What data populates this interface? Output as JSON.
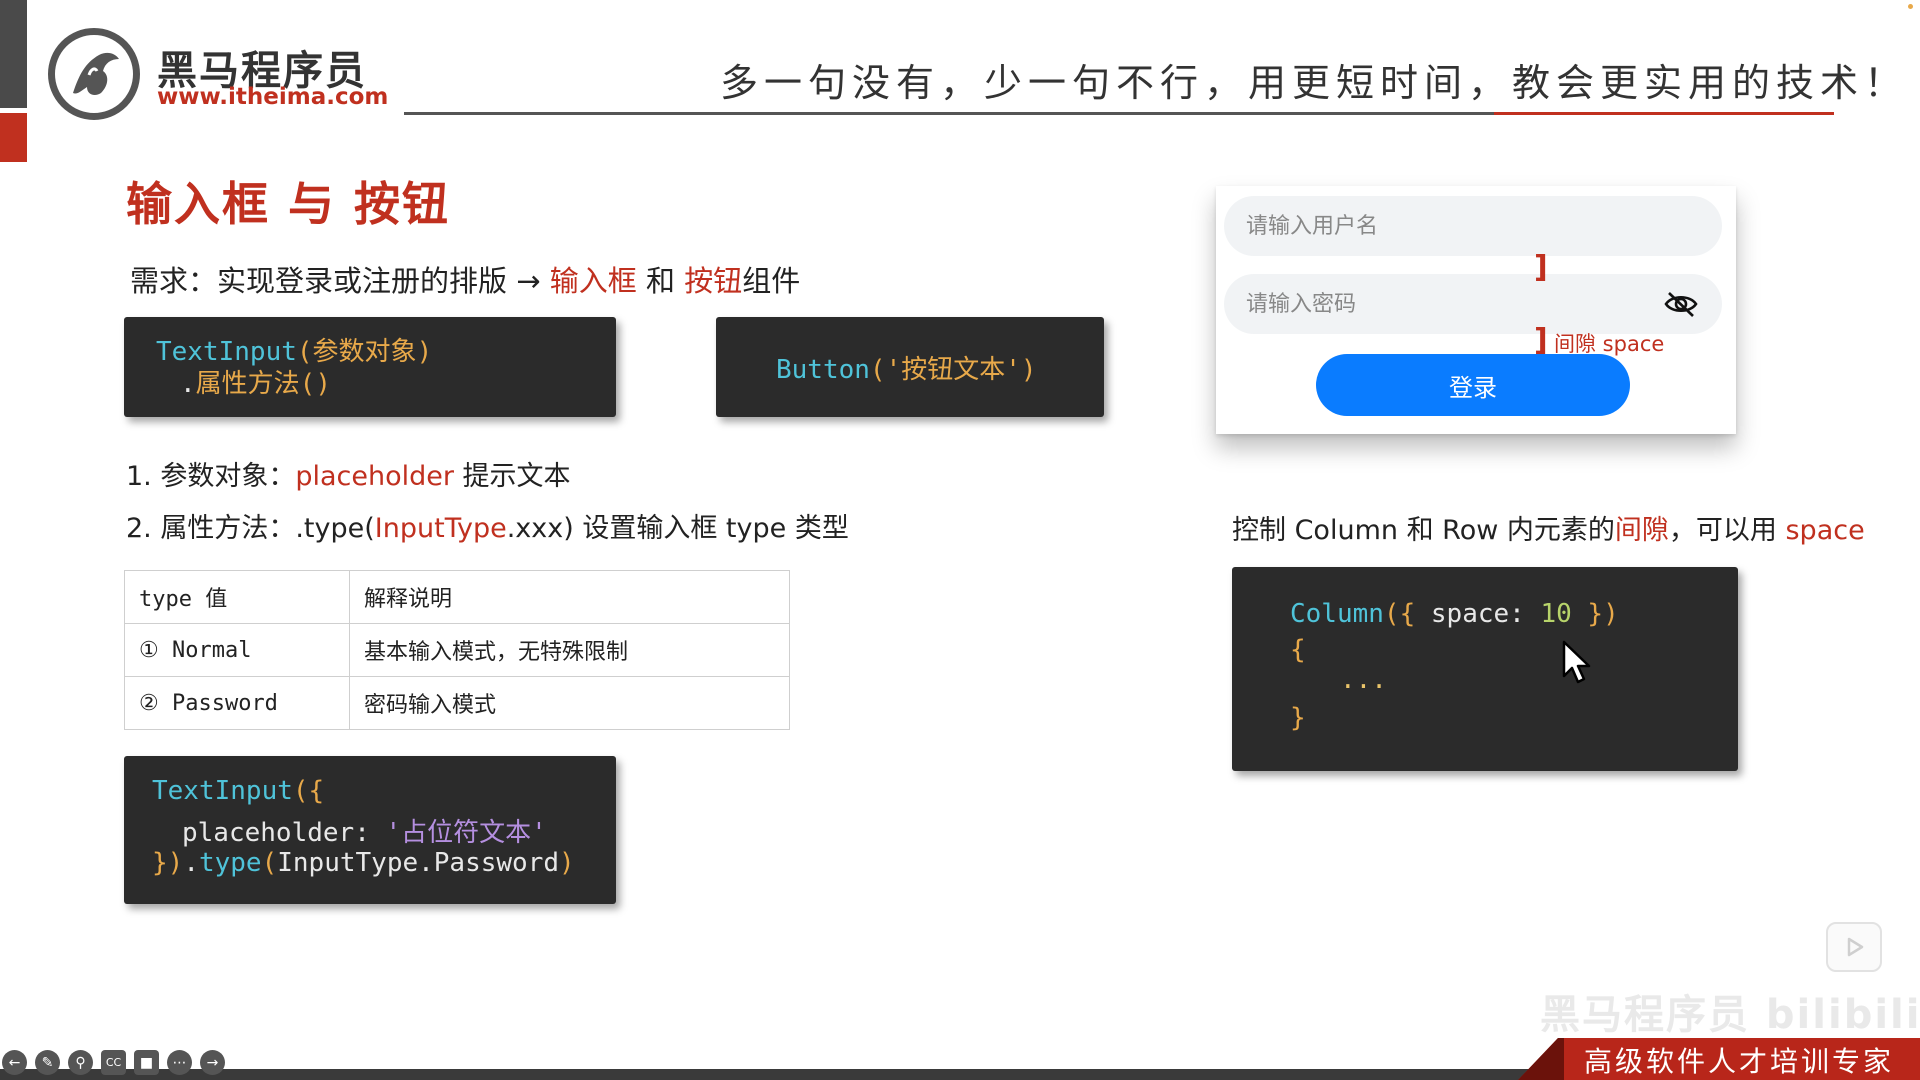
{
  "logo": {
    "name": "黑马程序员",
    "url": "www.itheima.com"
  },
  "header": {
    "slogan": "多一句没有，少一句不行，用更短时间，教会更实用的技术！"
  },
  "title": "输入框 与 按钮",
  "requirement": {
    "prefix": "需求：实现登录或注册的排版 → ",
    "input_word": "输入框",
    "and": " 和 ",
    "button_word": "按钮",
    "suffix": "组件"
  },
  "code_textinput": {
    "line1_name": "TextInput",
    "line1_open": "(",
    "line1_arg": "参数对象",
    "line1_close": ")",
    "line2_dot": ".",
    "line2_method": "属性方法",
    "line2_parens": "()"
  },
  "code_button": {
    "name": "Button",
    "open": "(",
    "arg": "'按钮文本'",
    "close": ")"
  },
  "notes": {
    "note1_prefix": "1. 参数对象：",
    "note1_highlight": "placeholder",
    "note1_suffix": " 提示文本",
    "note2_prefix": "2. 属性方法：.type(",
    "note2_highlight": "InputType",
    "note2_suffix": ".xxx)  设置输入框 type 类型"
  },
  "type_table": {
    "headers": [
      "type 值",
      "解释说明"
    ],
    "rows": [
      [
        "① Normal",
        "基本输入模式，无特殊限制"
      ],
      [
        "② Password",
        "密码输入模式"
      ]
    ]
  },
  "code_example": {
    "l1_name": "TextInput",
    "l1_brace": "({",
    "l2_key": "placeholder",
    "l2_colon": ": ",
    "l2_value": "'占位符文本'",
    "l3_close": "})",
    "l3_dot": ".",
    "l3_method": "type",
    "l3_open": "(",
    "l3_arg": "InputType.Password",
    "l3_end": ")"
  },
  "login_mock": {
    "username_placeholder": "请输入用户名",
    "password_placeholder": "请输入密码",
    "login_label": "登录",
    "gap_label": "间隙 space",
    "bracket": "]"
  },
  "space_note": {
    "prefix": "控制 Column 和 Row 内元素的",
    "highlight1": "间隙",
    "middle": "，可以用 ",
    "highlight2": "space"
  },
  "code_column": {
    "name": "Column",
    "open": "({",
    "key": " space",
    "colon": ": ",
    "value": "10",
    "close": " })",
    "brace_open": "{",
    "dots": "...",
    "brace_close": "}"
  },
  "banner": {
    "text": "高级软件人才培训专家"
  },
  "watermark": "黑马程序员 bilibili",
  "colors": {
    "accent_red": "#c0301f",
    "login_blue": "#0a7cff",
    "code_bg": "#2b2b2b"
  },
  "toolbar": {
    "icons": [
      "back-icon",
      "pen-icon",
      "zoom-icon",
      "cc-icon",
      "camera-icon",
      "more-icon",
      "forward-icon"
    ]
  }
}
